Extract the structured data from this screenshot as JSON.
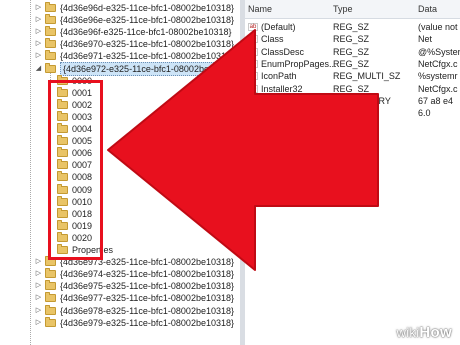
{
  "tree": {
    "top_keys": [
      "{4d36e96d-e325-11ce-bfc1-08002be10318}",
      "{4d36e96e-e325-11ce-bfc1-08002be10318}",
      "{4d36e96f-e325-11ce-bfc1-08002be10318}",
      "{4d36e970-e325-11ce-bfc1-08002be10318}",
      "{4d36e971-e325-11ce-bfc1-08002be10318}"
    ],
    "selected_key": "{4d36e972-e325-11ce-bfc1-08002be10318}",
    "subkeys": [
      "0000",
      "0001",
      "0002",
      "0003",
      "0004",
      "0005",
      "0006",
      "0007",
      "0008",
      "0009",
      "0010",
      "0018",
      "0019",
      "0020",
      "Properties"
    ],
    "bottom_keys": [
      "{4d36e973-e325-11ce-bfc1-08002be10318}",
      "{4d36e974-e325-11ce-bfc1-08002be10318}",
      "{4d36e975-e325-11ce-bfc1-08002be10318}",
      "{4d36e977-e325-11ce-bfc1-08002be10318}",
      "{4d36e978-e325-11ce-bfc1-08002be10318}",
      "{4d36e979-e325-11ce-bfc1-08002be10318}"
    ]
  },
  "values_pane": {
    "columns": {
      "name": "Name",
      "type": "Type",
      "data": "Data"
    },
    "rows": [
      {
        "icon": "ab",
        "name": "(Default)",
        "type": "REG_SZ",
        "data": "(value not"
      },
      {
        "icon": "ab",
        "name": "Class",
        "type": "REG_SZ",
        "data": "Net"
      },
      {
        "icon": "ab",
        "name": "ClassDesc",
        "type": "REG_SZ",
        "data": "@%Syster"
      },
      {
        "icon": "ab",
        "name": "EnumPropPages...",
        "type": "REG_SZ",
        "data": "NetCfgx.c"
      },
      {
        "icon": "ab",
        "name": "IconPath",
        "type": "REG_MULTI_SZ",
        "data": "%systemr"
      },
      {
        "icon": "ab",
        "name": "Installer32",
        "type": "REG_SZ",
        "data": "NetCfgx.c"
      },
      {
        "icon": "011",
        "name": "LastDeleteDate",
        "type": "REG_BINARY",
        "data": "67 a8 e4"
      },
      {
        "icon": "ab",
        "name": "LowerLogoVersi...",
        "type": "REG_SZ",
        "data": "6.0"
      }
    ]
  },
  "watermark": {
    "prefix": "wiki",
    "suffix": "How"
  },
  "colors": {
    "arrow": "#e8101e",
    "highlight": "#e8101e",
    "selection": "#cde4f7",
    "folder": "#e9c466"
  },
  "icons": {
    "folder": "folder-icon",
    "expand": "expand-arrow-icon",
    "value": "string-value-icon",
    "binary": "binary-value-icon"
  }
}
